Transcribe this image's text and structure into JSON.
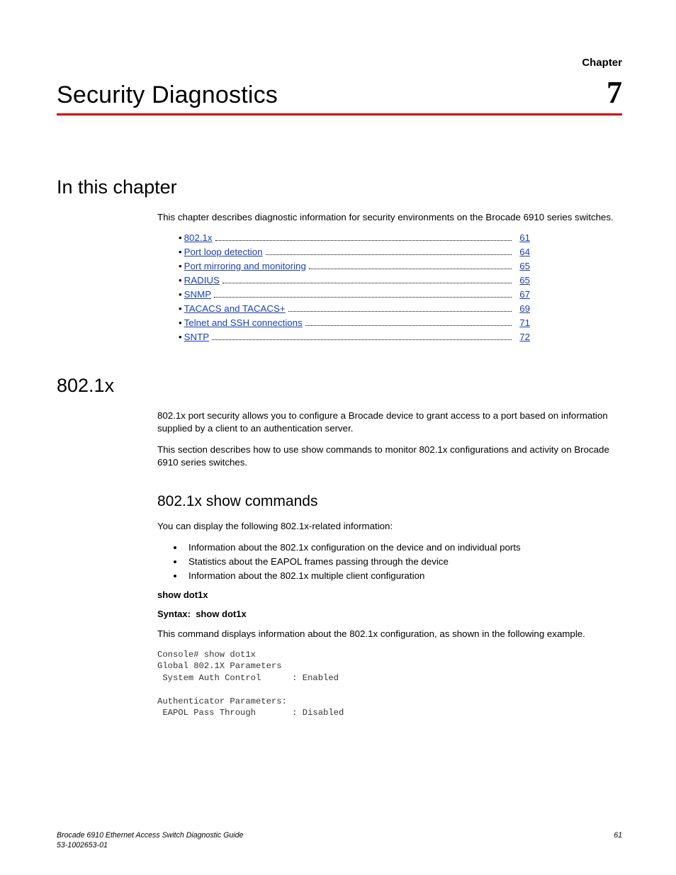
{
  "header": {
    "chapter_label": "Chapter",
    "title": "Security Diagnostics",
    "number": "7"
  },
  "section1": {
    "heading": "In this chapter",
    "intro": "This chapter describes diagnostic information for security environments on the Brocade 6910 series switches.",
    "toc": [
      {
        "label": "802.1x",
        "page": "61"
      },
      {
        "label": "Port loop detection",
        "page": "64"
      },
      {
        "label": "Port mirroring and monitoring",
        "page": "65"
      },
      {
        "label": "RADIUS",
        "page": "65"
      },
      {
        "label": "SNMP",
        "page": "67"
      },
      {
        "label": "TACACS and TACACS+",
        "page": "69"
      },
      {
        "label": "Telnet and SSH connections",
        "page": "71"
      },
      {
        "label": "SNTP",
        "page": "72"
      }
    ]
  },
  "section2": {
    "heading": "802.1x",
    "para1": "802.1x port security allows you to configure a Brocade device to grant access to a port based on information supplied by a client to an authentication server.",
    "para2": "This section describes how to use show commands to monitor 802.1x configurations and activity on Brocade 6910 series switches.",
    "sub": {
      "heading": "802.1x show commands",
      "intro": "You can display the following 802.1x-related information:",
      "bullets": [
        "Information about the 802.1x configuration on the device and on individual ports",
        "Statistics about the EAPOL frames passing through the device",
        "Information about the 802.1x multiple client configuration"
      ],
      "cmd_head": "show dot1x",
      "syntax_label": "Syntax:",
      "syntax_cmd": "show dot1x",
      "cmd_desc": "This command displays information about the 802.1x configuration, as shown in the following example.",
      "code": "Console# show dot1x\nGlobal 802.1X Parameters\n System Auth Control      : Enabled\n\nAuthenticator Parameters:\n EAPOL Pass Through       : Disabled"
    }
  },
  "footer": {
    "line1": "Brocade 6910 Ethernet Access Switch Diagnostic Guide",
    "line2": "53-1002653-01",
    "page": "61"
  }
}
